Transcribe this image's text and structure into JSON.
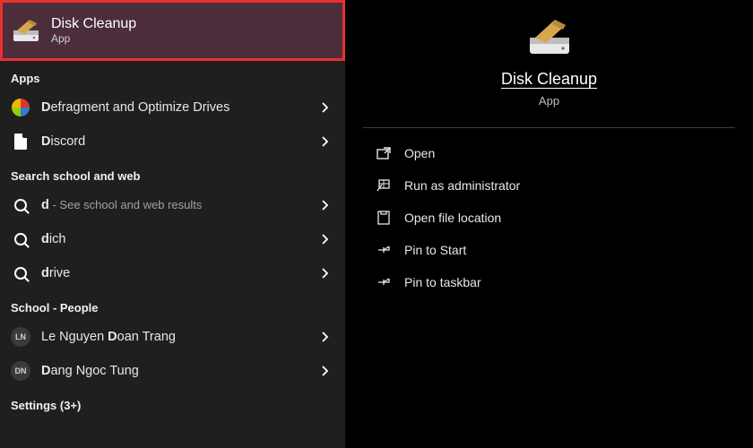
{
  "bestMatch": {
    "title": "Disk Cleanup",
    "subtitle": "App"
  },
  "sections": {
    "apps": "Apps",
    "searchWeb": "Search school and web",
    "people": "School - People",
    "settings": "Settings (3+)"
  },
  "apps": [
    {
      "label_pre": "D",
      "label_rest": "efragment and Optimize Drives",
      "icon": "defrag"
    },
    {
      "label_pre": "D",
      "label_rest": "iscord",
      "icon": "file"
    }
  ],
  "web": [
    {
      "label_pre": "d",
      "label_rest": "",
      "sub": " - See school and web results"
    },
    {
      "label_pre": "d",
      "label_rest": "ich",
      "sub": ""
    },
    {
      "label_pre": "d",
      "label_rest": "rive",
      "sub": ""
    }
  ],
  "people": [
    {
      "initials": "LN",
      "label_pre": "Le Nguyen ",
      "label_bold": "D",
      "label_rest": "oan Trang"
    },
    {
      "initials": "DN",
      "label_pre": "",
      "label_bold": "D",
      "label_rest": "ang Ngoc Tung"
    }
  ],
  "right": {
    "title": "Disk Cleanup",
    "subtitle": "App"
  },
  "actions": {
    "open": "Open",
    "runAdmin": "Run as administrator",
    "openLoc": "Open file location",
    "pinStart": "Pin to Start",
    "pinTaskbar": "Pin to taskbar"
  }
}
